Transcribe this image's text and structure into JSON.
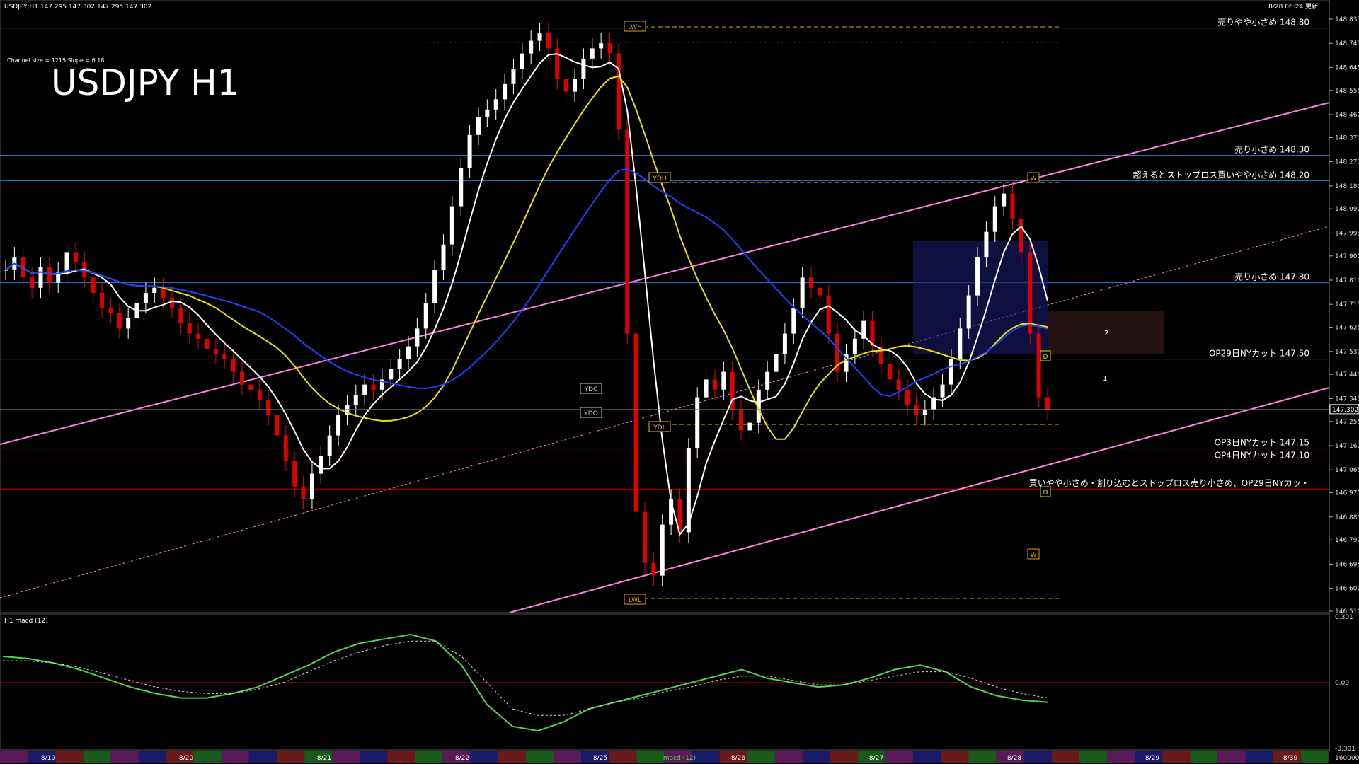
{
  "window": {
    "header_info": "USDJPY,H1  147.295 147.302 147.295 147.302",
    "channel_info": "Channel size = 1215 Slope = 6.18",
    "big_title": "USDJPY H1",
    "updated": "8/28 06:24 更新",
    "macd_panel_title": "H1  macd (12)",
    "macd_tab_label": "macd (12)"
  },
  "levels": [
    {
      "price": 148.8,
      "text": "売りやや小さめ 148.80",
      "color": "#3a74c9"
    },
    {
      "price": 148.3,
      "text": "売り小さめ 148.30",
      "color": "#3a74c9"
    },
    {
      "price": 148.2,
      "text": "超えるとストップロス買いやや小さめ 148.20",
      "color": "#3a74c9"
    },
    {
      "price": 147.8,
      "text": "売り小さめ 147.80",
      "color": "#3a74c9"
    },
    {
      "price": 147.5,
      "text": "OP29日NYカット 147.50",
      "color": "#3a74c9"
    },
    {
      "price": 147.15,
      "text": "OP3日NYカット 147.15",
      "color": "#c00000"
    },
    {
      "price": 147.1,
      "text": "OP4日NYカット 147.10",
      "color": "#c00000"
    },
    {
      "price": 146.99,
      "text": "買いやや小さめ・割り込むとストップロス売り小さめ、OP29日NYカッ・",
      "color": "#c00000"
    }
  ],
  "price_axis": {
    "ticks": [
      "148.835",
      "148.740",
      "148.645",
      "148.555",
      "148.460",
      "148.370",
      "148.275",
      "148.180",
      "148.090",
      "147.995",
      "147.905",
      "147.810",
      "147.715",
      "147.625",
      "147.530",
      "147.440",
      "147.345",
      "147.255",
      "147.160",
      "147.065",
      "146.975",
      "146.880",
      "146.790",
      "146.695",
      "146.600",
      "146.510"
    ],
    "current_price": "147.302"
  },
  "macd_axis": {
    "ticks": [
      "0.301",
      "0.00",
      "-0.301"
    ]
  },
  "date_axis": {
    "ticks": [
      "8/19",
      "8/20",
      "8/21",
      "8/22",
      "8/25",
      "8/26",
      "8/27",
      "8/28",
      "8/29",
      "8/30"
    ],
    "corner": "160000"
  },
  "markers": {
    "lwh": "LWH",
    "lwl": "LWL",
    "ydh": "YDH",
    "ydl": "YDL",
    "ydc": "YDC",
    "ydo": "YDO",
    "w_top": "W",
    "w_bottom": "W",
    "d_mid": "D",
    "d_bottom": "D",
    "proj_2": "2",
    "proj_1": "1"
  },
  "chart_data": [
    {
      "type": "candlestick",
      "title": "USDJPY H1",
      "x_range": [
        "8/19",
        "8/30"
      ],
      "ylim": [
        146.51,
        148.87
      ],
      "x": [
        0,
        1,
        2,
        3,
        4,
        5,
        6,
        7,
        8,
        9,
        10,
        11,
        12,
        13,
        14,
        15,
        16,
        17,
        18,
        19,
        20,
        21,
        22,
        23,
        24,
        25,
        26,
        27,
        28,
        29,
        30,
        31,
        32,
        33,
        34,
        35,
        36,
        37,
        38,
        39,
        40,
        41,
        42,
        43,
        44,
        45,
        46,
        47,
        48,
        49,
        50,
        51,
        52,
        53,
        54,
        55,
        56,
        57,
        58,
        59,
        60,
        61,
        62,
        63,
        64,
        65,
        66,
        67,
        68,
        69,
        70,
        71,
        72,
        73,
        74,
        75,
        76,
        77,
        78,
        79,
        80,
        81,
        82,
        83,
        84,
        85,
        86,
        87,
        88,
        89,
        90,
        91,
        92,
        93,
        94,
        95,
        96,
        97,
        98,
        99,
        100,
        101,
        102,
        103,
        104,
        105,
        106,
        107,
        108,
        109,
        110,
        111,
        112,
        113,
        114,
        115,
        116,
        117,
        118,
        119
      ],
      "close": [
        147.85,
        147.9,
        147.82,
        147.78,
        147.86,
        147.8,
        147.84,
        147.92,
        147.88,
        147.82,
        147.76,
        147.7,
        147.68,
        147.62,
        147.66,
        147.72,
        147.76,
        147.78,
        147.74,
        147.7,
        147.64,
        147.6,
        147.58,
        147.54,
        147.52,
        147.5,
        147.45,
        147.4,
        147.38,
        147.34,
        147.28,
        147.2,
        147.1,
        147.0,
        146.95,
        147.05,
        147.12,
        147.2,
        147.28,
        147.32,
        147.36,
        147.4,
        147.38,
        147.42,
        147.46,
        147.5,
        147.55,
        147.62,
        147.72,
        147.85,
        147.95,
        148.1,
        148.25,
        148.38,
        148.45,
        148.48,
        148.52,
        148.58,
        148.64,
        148.7,
        148.75,
        148.78,
        148.72,
        148.6,
        148.55,
        148.6,
        148.68,
        148.72,
        148.74,
        148.7,
        148.4,
        147.6,
        146.9,
        146.7,
        146.65,
        146.85,
        146.95,
        146.82,
        147.15,
        147.35,
        147.42,
        147.38,
        147.45,
        147.3,
        147.22,
        147.25,
        147.38,
        147.45,
        147.52,
        147.6,
        147.7,
        147.82,
        147.78,
        147.75,
        147.6,
        147.45,
        147.52,
        147.58,
        147.65,
        147.55,
        147.48,
        147.42,
        147.38,
        147.32,
        147.28,
        147.3,
        147.35,
        147.4,
        147.5,
        147.62,
        147.75,
        147.9,
        148.0,
        148.1,
        148.15,
        148.05,
        147.92,
        147.6,
        147.35,
        147.3
      ]
    },
    {
      "type": "line",
      "title": "H1  macd (12)",
      "ylim": [
        -0.301,
        0.301
      ],
      "series": [
        {
          "color": "#50d250",
          "values": [
            0.12,
            0.11,
            0.09,
            0.06,
            0.02,
            -0.02,
            -0.05,
            -0.07,
            -0.07,
            -0.05,
            -0.02,
            0.03,
            0.08,
            0.14,
            0.18,
            0.2,
            0.22,
            0.19,
            0.08,
            -0.1,
            -0.2,
            -0.22,
            -0.18,
            -0.12,
            -0.09,
            -0.06,
            -0.03,
            0.0,
            0.03,
            0.06,
            0.02,
            0.0,
            -0.02,
            -0.01,
            0.02,
            0.06,
            0.08,
            0.05,
            -0.02,
            -0.06,
            -0.08,
            -0.09
          ]
        },
        {
          "color": "#dcdcdc",
          "values": [
            0.1,
            0.1,
            0.09,
            0.07,
            0.04,
            0.01,
            -0.02,
            -0.04,
            -0.05,
            -0.05,
            -0.03,
            0.0,
            0.05,
            0.1,
            0.14,
            0.17,
            0.19,
            0.19,
            0.12,
            0.0,
            -0.12,
            -0.15,
            -0.15,
            -0.12,
            -0.09,
            -0.07,
            -0.04,
            -0.02,
            0.01,
            0.03,
            0.03,
            0.01,
            -0.01,
            -0.01,
            0.01,
            0.03,
            0.05,
            0.05,
            0.02,
            -0.02,
            -0.05,
            -0.07
          ]
        }
      ]
    }
  ]
}
